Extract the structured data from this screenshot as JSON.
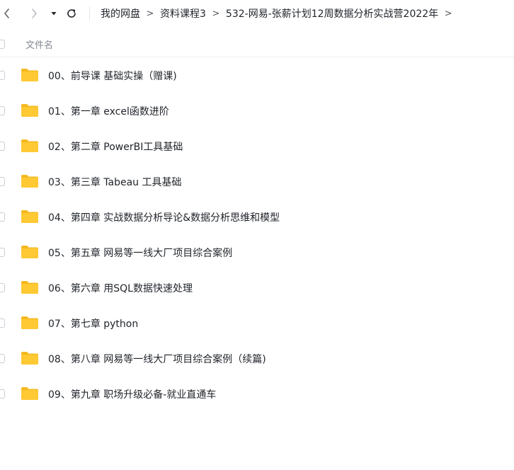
{
  "toolbar": {
    "back_icon": "chevron-left-icon",
    "forward_icon": "chevron-right-icon",
    "history_icon": "caret-down-icon",
    "refresh_icon": "refresh-icon"
  },
  "breadcrumb": {
    "items": [
      "我的网盘",
      "资料课程3",
      "532-网易-张薪计划12周数据分析实战营2022年"
    ],
    "separator": ">"
  },
  "header": {
    "name_column": "文件名"
  },
  "files": [
    {
      "name": "00、前导课 基础实操（赠课)",
      "type": "folder"
    },
    {
      "name": "01、第一章 excel函数进阶",
      "type": "folder"
    },
    {
      "name": "02、第二章 PowerBI工具基础",
      "type": "folder"
    },
    {
      "name": "03、第三章 Tabeau 工具基础",
      "type": "folder"
    },
    {
      "name": "04、第四章 实战数据分析导论&数据分析思维和模型",
      "type": "folder"
    },
    {
      "name": "05、第五章 网易等一线大厂项目综合案例",
      "type": "folder"
    },
    {
      "name": "06、第六章 用SQL数据快速处理",
      "type": "folder"
    },
    {
      "name": "07、第七章 python",
      "type": "folder"
    },
    {
      "name": "08、第八章 网易等一线大厂项目综合案例（续篇)",
      "type": "folder"
    },
    {
      "name": "09、第九章 职场升级必备-就业直通车",
      "type": "folder"
    }
  ],
  "colors": {
    "folder": "#ffc933",
    "folder_tab": "#f5b81f",
    "text": "#1f2329",
    "muted": "#84888f"
  }
}
